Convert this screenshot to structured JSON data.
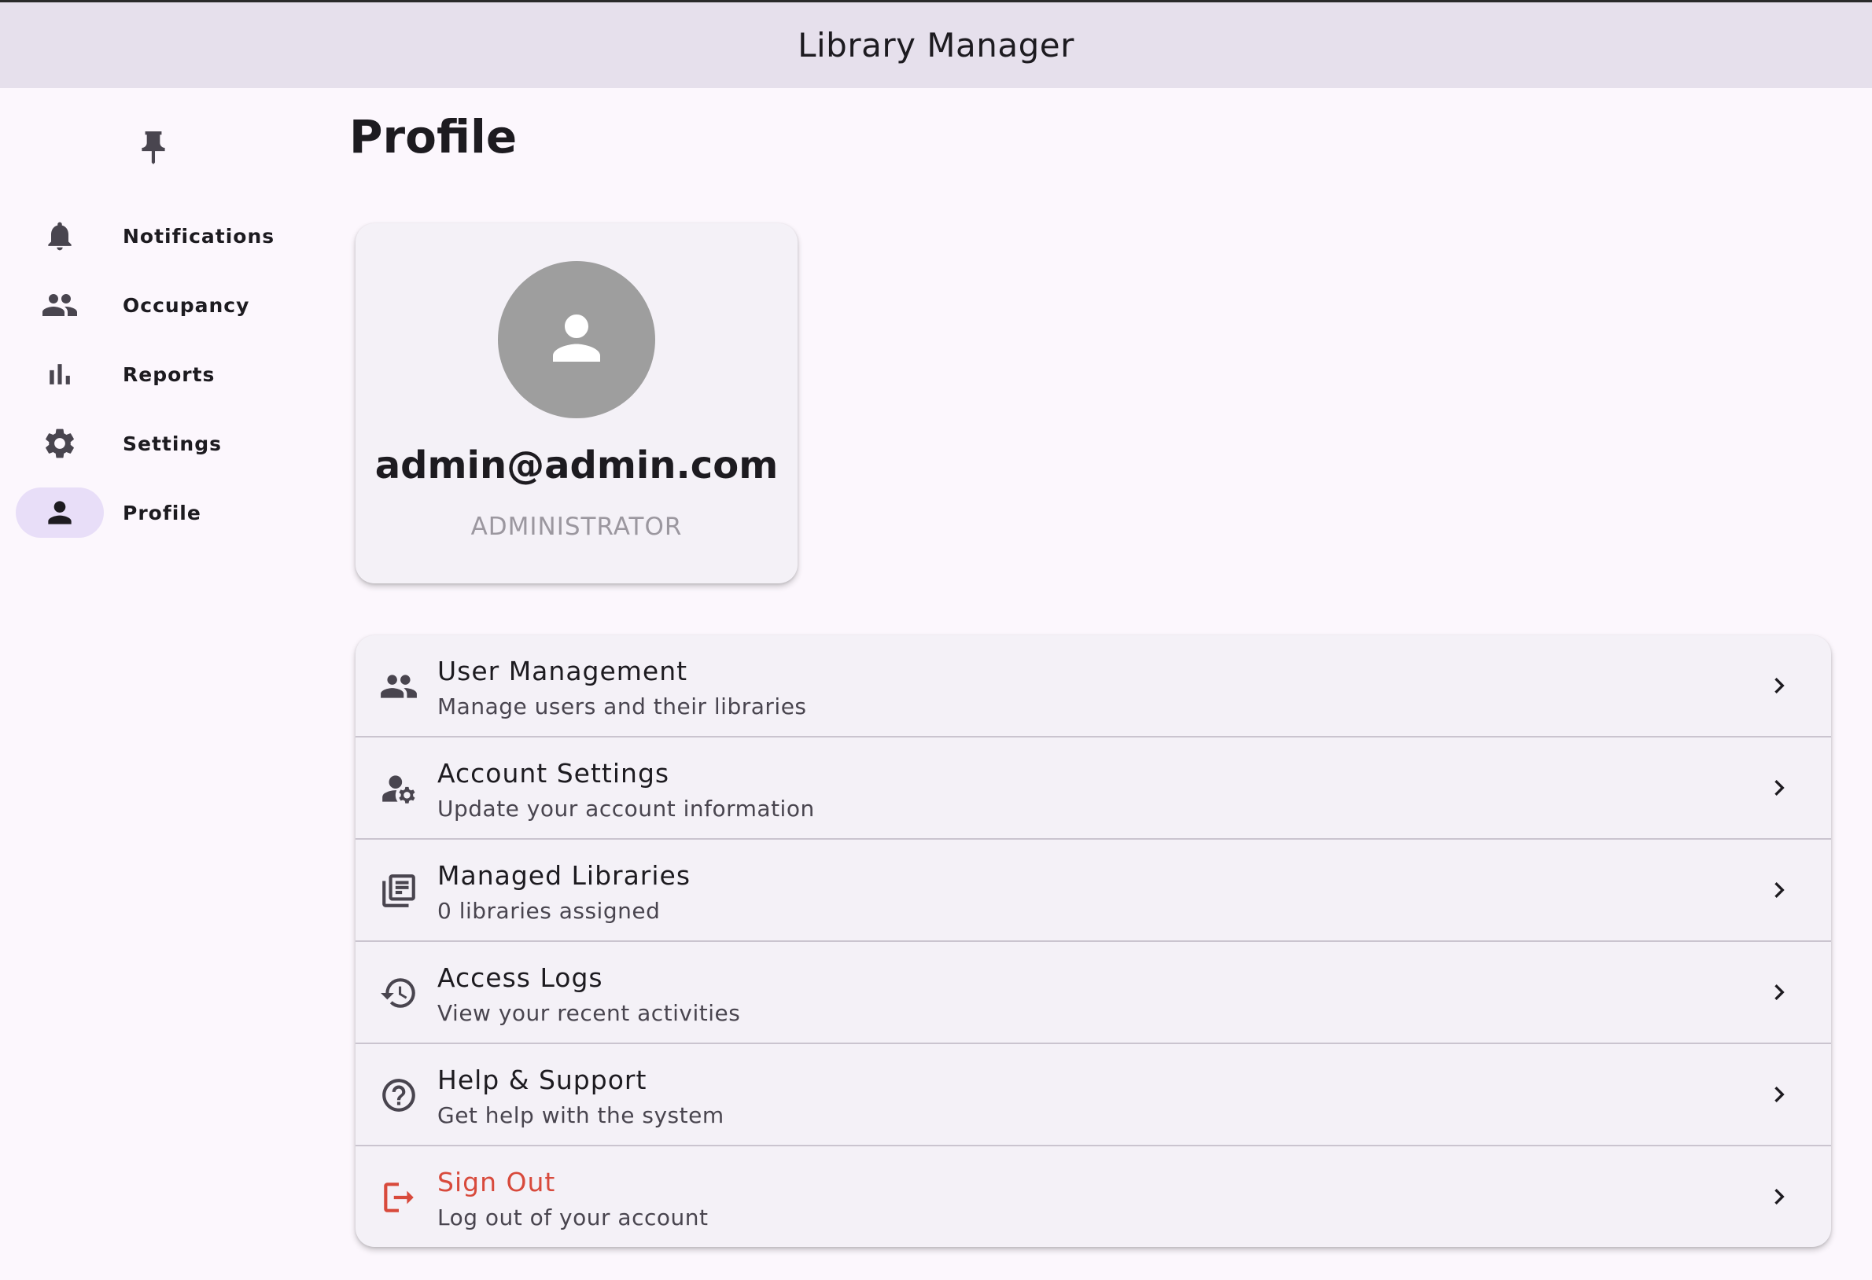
{
  "app": {
    "title": "Library Manager"
  },
  "sidebar": {
    "pin_icon": "pin-icon",
    "items": [
      {
        "label": "Notifications",
        "icon": "bell-icon",
        "active": false
      },
      {
        "label": "Occupancy",
        "icon": "people-icon",
        "active": false
      },
      {
        "label": "Reports",
        "icon": "bar-chart-icon",
        "active": false
      },
      {
        "label": "Settings",
        "icon": "gear-icon",
        "active": false
      },
      {
        "label": "Profile",
        "icon": "person-icon",
        "active": true
      }
    ]
  },
  "page": {
    "title": "Profile"
  },
  "profile": {
    "avatar_icon": "person-icon",
    "email": "admin@admin.com",
    "role": "ADMINISTRATOR"
  },
  "menu": {
    "items": [
      {
        "title": "User Management",
        "subtitle": "Manage users and their libraries",
        "icon": "people-icon"
      },
      {
        "title": "Account Settings",
        "subtitle": "Update your account information",
        "icon": "manage-accounts-icon"
      },
      {
        "title": "Managed Libraries",
        "subtitle": "0 libraries assigned",
        "icon": "library-books-icon"
      },
      {
        "title": "Access Logs",
        "subtitle": "View your recent activities",
        "icon": "history-icon"
      },
      {
        "title": "Help & Support",
        "subtitle": "Get help with the system",
        "icon": "help-icon"
      },
      {
        "title": "Sign Out",
        "subtitle": "Log out of your account",
        "icon": "logout-icon"
      }
    ]
  },
  "colors": {
    "app_bar": "#e6e0ec",
    "background": "#fcf7fd",
    "active_nav": "#e8def8",
    "danger": "#d84a3c",
    "avatar": "#9e9e9e"
  }
}
